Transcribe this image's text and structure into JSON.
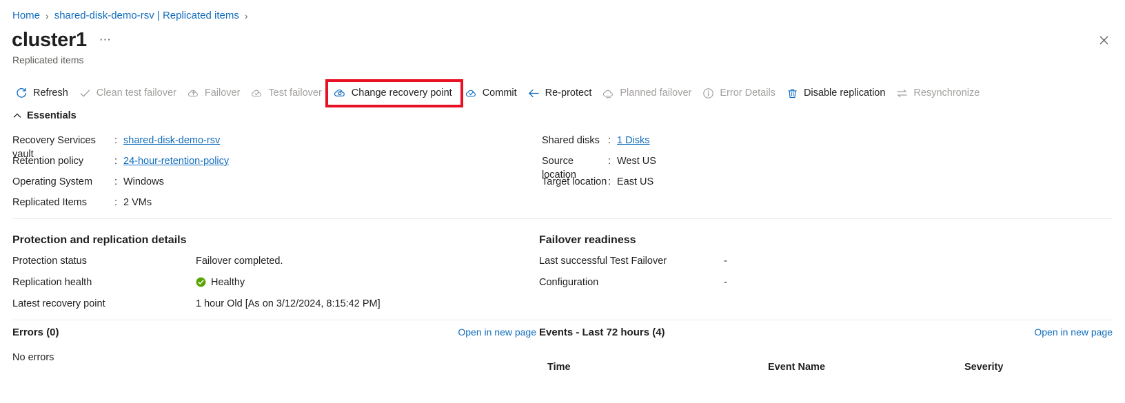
{
  "breadcrumb": {
    "items": [
      {
        "label": "Home"
      },
      {
        "label": "shared-disk-demo-rsv | Replicated items"
      }
    ],
    "separator": "›"
  },
  "header": {
    "title": "cluster1",
    "ellipsis": "⋯",
    "subtitle": "Replicated items",
    "close_icon": "close-icon"
  },
  "toolbar": {
    "items": [
      {
        "label": "Refresh",
        "icon": "refresh-icon",
        "disabled": false,
        "highlighted": false
      },
      {
        "label": "Clean test failover",
        "icon": "checkmark-icon",
        "disabled": true,
        "highlighted": false
      },
      {
        "label": "Failover",
        "icon": "failover-cloud-icon",
        "disabled": true,
        "highlighted": false
      },
      {
        "label": "Test failover",
        "icon": "test-failover-icon",
        "disabled": true,
        "highlighted": false
      },
      {
        "label": "Change recovery point",
        "icon": "recovery-point-icon",
        "disabled": false,
        "highlighted": true
      },
      {
        "label": "Commit",
        "icon": "commit-icon",
        "disabled": false,
        "highlighted": false
      },
      {
        "label": "Re-protect",
        "icon": "arrow-left-icon",
        "disabled": false,
        "highlighted": false
      },
      {
        "label": "Planned failover",
        "icon": "planned-failover-icon",
        "disabled": true,
        "highlighted": false
      },
      {
        "label": "Error Details",
        "icon": "info-icon",
        "disabled": true,
        "highlighted": false
      },
      {
        "label": "Disable replication",
        "icon": "trash-icon",
        "disabled": false,
        "highlighted": false
      },
      {
        "label": "Resynchronize",
        "icon": "resync-icon",
        "disabled": true,
        "highlighted": false
      }
    ],
    "highlight_color": "#e81123"
  },
  "essentials": {
    "heading": "Essentials",
    "chevron_icon": "chevron-up-icon",
    "left": [
      {
        "label": "Recovery Services vault",
        "colon": ":",
        "value": "shared-disk-demo-rsv",
        "link": true
      },
      {
        "label": "Retention policy",
        "colon": ":",
        "value": "24-hour-retention-policy",
        "link": true
      },
      {
        "label": "Operating System",
        "colon": ":",
        "value": "Windows",
        "link": false
      },
      {
        "label": "Replicated Items",
        "colon": ":",
        "value": "2 VMs",
        "link": false
      }
    ],
    "right": [
      {
        "label": "Shared disks",
        "colon": ":",
        "value": "1 Disks",
        "link": true
      },
      {
        "label": "Source location",
        "colon": ":",
        "value": "West US",
        "link": false
      },
      {
        "label": "Target location",
        "colon": ":",
        "value": "East US",
        "link": false
      }
    ]
  },
  "protection": {
    "title": "Protection and replication details",
    "rows": [
      {
        "key": "Protection status",
        "value": "Failover completed.",
        "icon": null
      },
      {
        "key": "Replication health",
        "value": "Healthy",
        "icon": "health-ok-icon"
      },
      {
        "key": "Latest recovery point",
        "value": "1 hour Old [As on 3/12/2024, 8:15:42 PM]",
        "icon": null
      }
    ],
    "health_color": "#57a300"
  },
  "failover_readiness": {
    "title": "Failover readiness",
    "rows": [
      {
        "key": "Last successful Test Failover",
        "value": "-"
      },
      {
        "key": "Configuration",
        "value": "-"
      }
    ]
  },
  "errors_panel": {
    "title": "Errors (0)",
    "link": "Open in new page",
    "empty_text": "No errors"
  },
  "events_panel": {
    "title": "Events - Last 72 hours (4)",
    "link": "Open in new page",
    "columns": [
      "Time",
      "Event Name",
      "Severity"
    ],
    "rows": []
  },
  "colors": {
    "link": "#0f6cbd",
    "text": "#201f1e",
    "muted": "#605e5c",
    "disabled": "#a19f9d",
    "divider": "#edebe9",
    "accent_red": "#e81123",
    "green": "#57a300"
  }
}
